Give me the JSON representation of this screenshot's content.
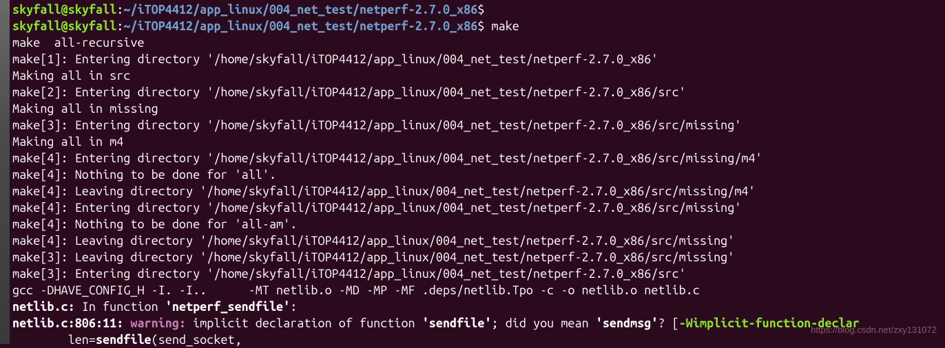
{
  "prompt0": {
    "userhost": "skyfall@skyfall",
    "colon": ":",
    "path": "~/iTOP4412/app_linux/004_net_test/netperf-2.7.0_x86",
    "dollar": "$"
  },
  "prompt1": {
    "userhost": "skyfall@skyfall",
    "colon": ":",
    "path": "~/iTOP4412/app_linux/004_net_test/netperf-2.7.0_x86",
    "dollar": "$",
    "cmd": " make"
  },
  "lines": {
    "l1": "make  all-recursive",
    "l2": "make[1]: Entering directory '/home/skyfall/iTOP4412/app_linux/004_net_test/netperf-2.7.0_x86'",
    "l3": "Making all in src",
    "l4": "make[2]: Entering directory '/home/skyfall/iTOP4412/app_linux/004_net_test/netperf-2.7.0_x86/src'",
    "l5": "Making all in missing",
    "l6": "make[3]: Entering directory '/home/skyfall/iTOP4412/app_linux/004_net_test/netperf-2.7.0_x86/src/missing'",
    "l7": "Making all in m4",
    "l8": "make[4]: Entering directory '/home/skyfall/iTOP4412/app_linux/004_net_test/netperf-2.7.0_x86/src/missing/m4'",
    "l9": "make[4]: Nothing to be done for 'all'.",
    "l10": "make[4]: Leaving directory '/home/skyfall/iTOP4412/app_linux/004_net_test/netperf-2.7.0_x86/src/missing/m4'",
    "l11": "make[4]: Entering directory '/home/skyfall/iTOP4412/app_linux/004_net_test/netperf-2.7.0_x86/src/missing'",
    "l12": "make[4]: Nothing to be done for 'all-am'.",
    "l13": "make[4]: Leaving directory '/home/skyfall/iTOP4412/app_linux/004_net_test/netperf-2.7.0_x86/src/missing'",
    "l14": "make[3]: Leaving directory '/home/skyfall/iTOP4412/app_linux/004_net_test/netperf-2.7.0_x86/src/missing'",
    "l15": "make[3]: Entering directory '/home/skyfall/iTOP4412/app_linux/004_net_test/netperf-2.7.0_x86/src'",
    "l16": "gcc -DHAVE_CONFIG_H -I. -I..      -MT netlib.o -MD -MP -MF .deps/netlib.Tpo -c -o netlib.o netlib.c"
  },
  "warn1": {
    "file": "netlib.c:",
    "msg1": " In function ",
    "func": "'netperf_sendfile'",
    "colon": ":"
  },
  "warn2": {
    "loc": "netlib.c:806:11: ",
    "label": "warning:",
    "msg_a": " implicit declaration of function ",
    "sendfile": "'sendfile'",
    "msg_b": "; did you mean ",
    "sendmsg": "'sendmsg'",
    "msg_c": "? [",
    "opt": "-Wimplicit-function-declar",
    "tail": ""
  },
  "warn3": {
    "indent": "        len=",
    "fn": "sendfile",
    "rest": "(send_socket,"
  },
  "watermark": "https://blog.csdn.net/zxy131072"
}
